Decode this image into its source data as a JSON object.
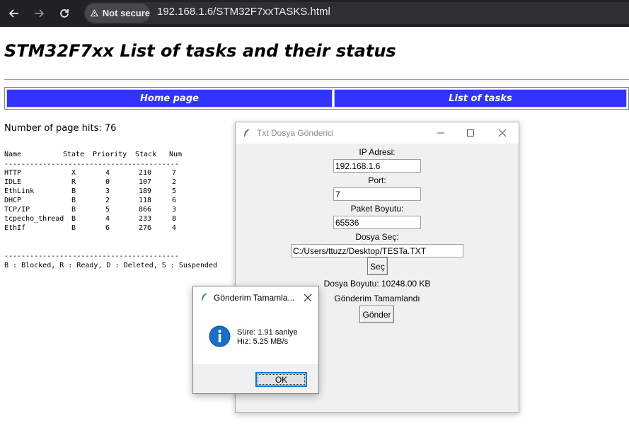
{
  "browser": {
    "security_label": "Not secure",
    "url": "192.168.1.6/STM32F7xxTASKS.html"
  },
  "page": {
    "title": "STM32F7xx List of tasks and their status",
    "nav": [
      "Home page",
      "List of tasks"
    ],
    "hits_text": "Number of page hits: 76",
    "table": {
      "headers": [
        "Name",
        "State",
        "Priority",
        "Stack",
        "Num"
      ],
      "separator": "-----------------------------------------",
      "rows": [
        [
          "HTTP",
          "X",
          "4",
          "210",
          "7"
        ],
        [
          "IDLE",
          "R",
          "0",
          "107",
          "2"
        ],
        [
          "EthLink",
          "B",
          "3",
          "189",
          "5"
        ],
        [
          "DHCP",
          "B",
          "2",
          "118",
          "6"
        ],
        [
          "TCP/IP",
          "B",
          "5",
          "866",
          "3"
        ],
        [
          "tcpecho_thread",
          "B",
          "4",
          "233",
          "8"
        ],
        [
          "EthIf",
          "B",
          "6",
          "276",
          "4"
        ]
      ],
      "legend": "B : Blocked, R : Ready, D : Deleted, S : Suspended"
    }
  },
  "tk_window": {
    "title": "Txt Dosya Gönderici",
    "ip_label": "IP Adresi:",
    "ip_value": "192.168.1.6",
    "port_label": "Port:",
    "port_value": "7",
    "packet_label": "Paket Boyutu:",
    "packet_value": "65536",
    "file_label": "Dosya Seç:",
    "file_value": "C:/Users/ttuzz/Desktop/TESTa.TXT",
    "select_button": "Seç",
    "file_size_text": "Dosya Boyutu: 10248.00 KB",
    "status_text": "Gönderim Tamamlandı",
    "send_button": "Gönder"
  },
  "dialog": {
    "title": "Gönderim Tamamla...",
    "line1": "Süre: 1.91 saniye",
    "line2": "Hız: 5.25 MB/s",
    "ok_button": "OK"
  },
  "colors": {
    "nav_blue": "#3333ff",
    "browser_dark": "#202124",
    "info_icon": "#1a6fc4"
  }
}
